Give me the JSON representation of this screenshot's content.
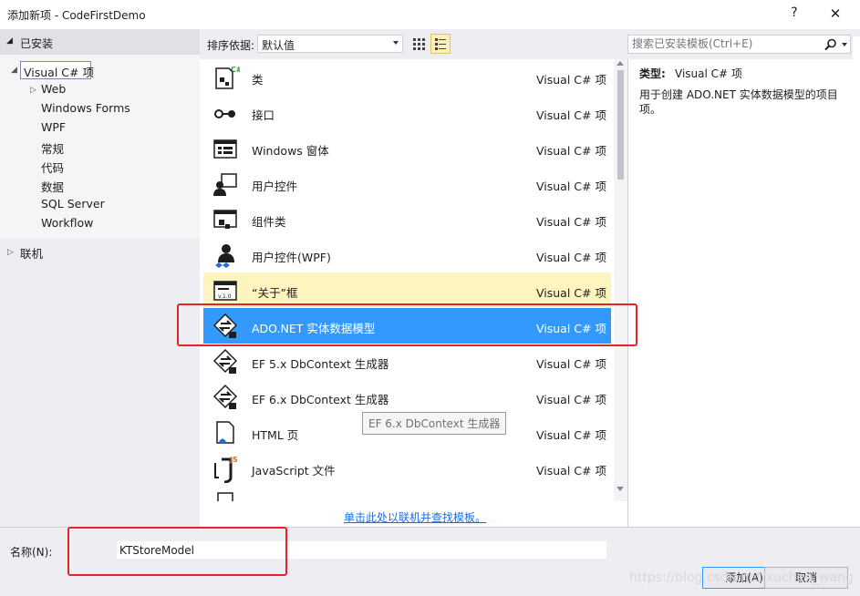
{
  "window": {
    "title": "添加新项 - CodeFirstDemo",
    "help": "?",
    "close": "✕"
  },
  "left": {
    "installed": "已安装",
    "tree": [
      "Visual C# 项",
      "Web",
      "Windows Forms",
      "WPF",
      "常规",
      "代码",
      "数据",
      "SQL Server",
      "Workflow"
    ],
    "online": "联机"
  },
  "toolbar": {
    "sort_label": "排序依据:",
    "sort_value": "默认值",
    "search_placeholder": "搜索已安装模板(Ctrl+E)"
  },
  "templates": [
    {
      "name": "类",
      "type": "Visual C# 项"
    },
    {
      "name": "接口",
      "type": "Visual C# 项"
    },
    {
      "name": "Windows 窗体",
      "type": "Visual C# 项"
    },
    {
      "name": "用户控件",
      "type": "Visual C# 项"
    },
    {
      "name": "组件类",
      "type": "Visual C# 项"
    },
    {
      "name": "用户控件(WPF)",
      "type": "Visual C# 项"
    },
    {
      "name": "“关于”框",
      "type": "Visual C# 项"
    },
    {
      "name": "ADO.NET 实体数据模型",
      "type": "Visual C# 项"
    },
    {
      "name": "EF 5.x DbContext 生成器",
      "type": "Visual C# 项"
    },
    {
      "name": "EF 6.x DbContext 生成器",
      "type": "Visual C# 项"
    },
    {
      "name": "HTML 页",
      "type": "Visual C# 项"
    },
    {
      "name": "JavaScript 文件",
      "type": "Visual C# 项"
    }
  ],
  "tooltip": "EF 6.x DbContext 生成器",
  "online_link": "单击此处以联机并查找模板。",
  "details": {
    "type_label": "类型:",
    "type_value": "Visual C# 项",
    "description": "用于创建 ADO.NET 实体数据模型的项目项。"
  },
  "bottom": {
    "name_label": "名称(N):",
    "name_value": "KTStoreModel",
    "add": "添加(A)",
    "cancel": "取消"
  },
  "watermark": "https://blog.csdn.net/xuchen_wang",
  "colors": {
    "selected": "#3399ff",
    "hover": "#fdf4bf",
    "highlight_box": "#e8222a",
    "link": "#1a6fe0"
  }
}
